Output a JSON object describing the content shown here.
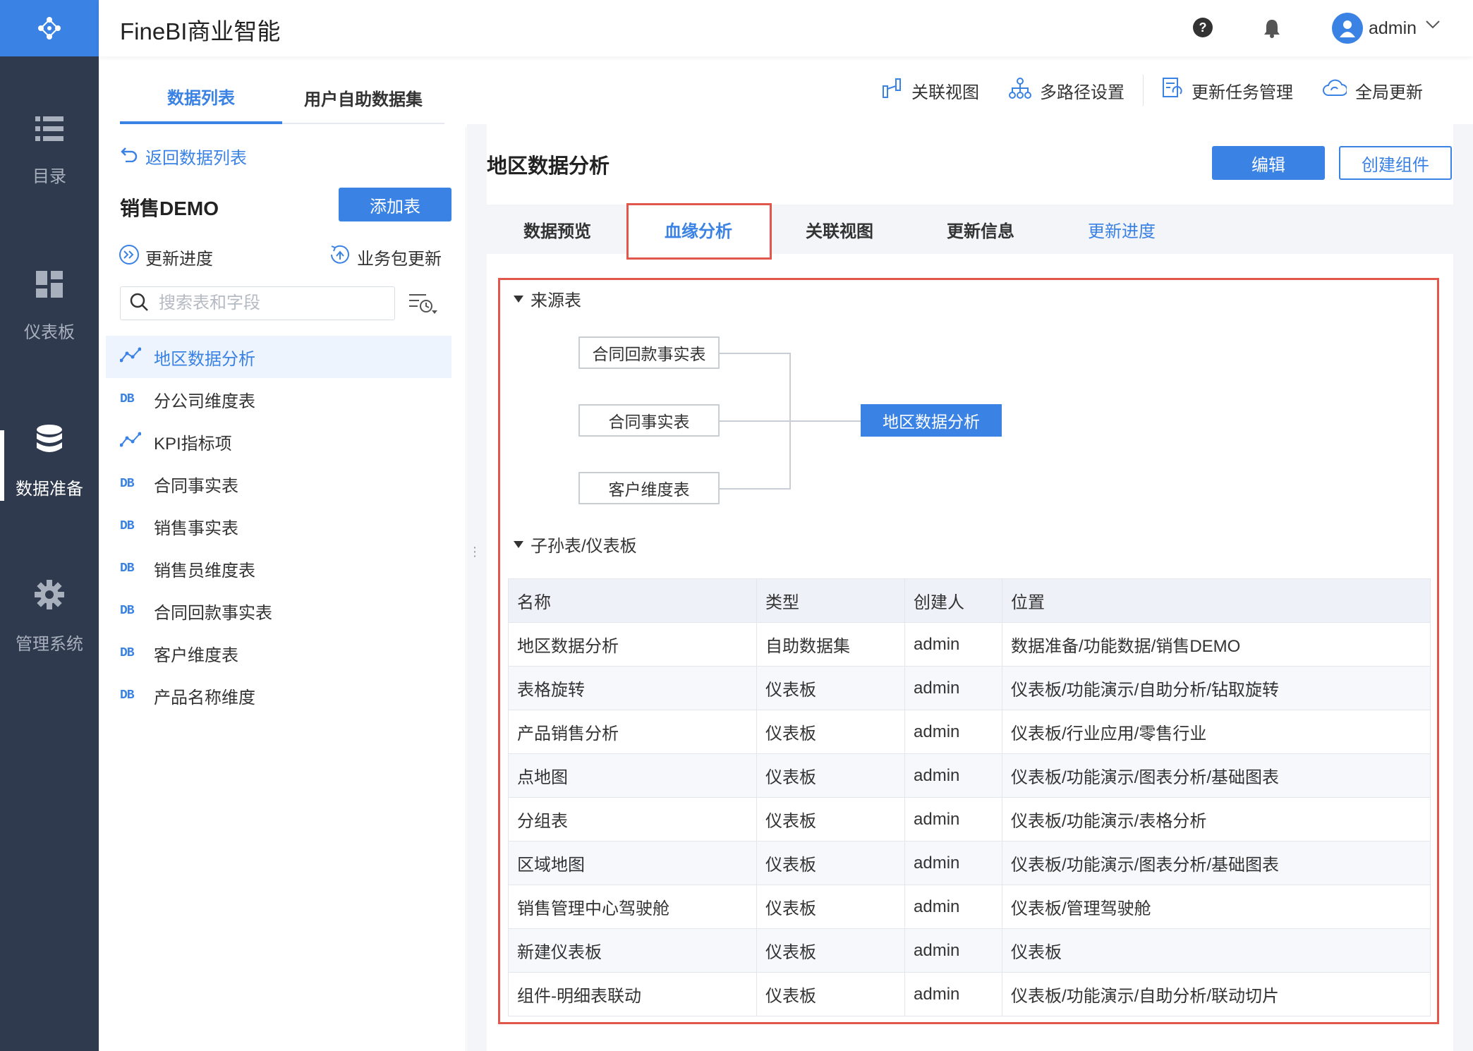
{
  "app": {
    "title": "FineBI商业智能"
  },
  "nav": {
    "items": [
      {
        "label": "目录",
        "icon": "list-icon"
      },
      {
        "label": "仪表板",
        "icon": "dashboard-icon"
      },
      {
        "label": "数据准备",
        "icon": "database-icon",
        "active": true
      },
      {
        "label": "管理系统",
        "icon": "gear-icon"
      }
    ]
  },
  "header": {
    "user": "admin"
  },
  "left": {
    "tabs": [
      "数据列表",
      "用户自助数据集"
    ],
    "back": "返回数据列表",
    "package_title": "销售DEMO",
    "add_table": "添加表",
    "update_progress": "更新进度",
    "package_update": "业务包更新",
    "search_placeholder": "搜索表和字段",
    "tables": [
      {
        "name": "地区数据分析",
        "type": "self-service",
        "active": true
      },
      {
        "name": "分公司维度表",
        "type": "DB"
      },
      {
        "name": "KPI指标项",
        "type": "self-service"
      },
      {
        "name": "合同事实表",
        "type": "DB"
      },
      {
        "name": "销售事实表",
        "type": "DB"
      },
      {
        "name": "销售员维度表",
        "type": "DB"
      },
      {
        "name": "合同回款事实表",
        "type": "DB"
      },
      {
        "name": "客户维度表",
        "type": "DB"
      },
      {
        "name": "产品名称维度",
        "type": "DB"
      }
    ],
    "db_badge": "DB"
  },
  "toolbar": {
    "items": [
      "关联视图",
      "多路径设置",
      "更新任务管理",
      "全局更新"
    ]
  },
  "main": {
    "title": "地区数据分析",
    "edit": "编辑",
    "create": "创建组件",
    "tabs": [
      "数据预览",
      "血缘分析",
      "关联视图",
      "更新信息",
      "更新进度"
    ],
    "source_section": "来源表",
    "sources": [
      "合同回款事实表",
      "合同事实表",
      "客户维度表"
    ],
    "result": "地区数据分析",
    "child_section": "子孙表/仪表板",
    "table_headers": [
      "名称",
      "类型",
      "创建人",
      "位置"
    ],
    "rows": [
      [
        "地区数据分析",
        "自助数据集",
        "admin",
        "数据准备/功能数据/销售DEMO"
      ],
      [
        "表格旋转",
        "仪表板",
        "admin",
        "仪表板/功能演示/自助分析/钻取旋转"
      ],
      [
        "产品销售分析",
        "仪表板",
        "admin",
        "仪表板/行业应用/零售行业"
      ],
      [
        "点地图",
        "仪表板",
        "admin",
        "仪表板/功能演示/图表分析/基础图表"
      ],
      [
        "分组表",
        "仪表板",
        "admin",
        "仪表板/功能演示/表格分析"
      ],
      [
        "区域地图",
        "仪表板",
        "admin",
        "仪表板/功能演示/图表分析/基础图表"
      ],
      [
        "销售管理中心驾驶舱",
        "仪表板",
        "admin",
        "仪表板/管理驾驶舱"
      ],
      [
        "新建仪表板",
        "仪表板",
        "admin",
        "仪表板"
      ],
      [
        "组件-明细表联动",
        "仪表板",
        "admin",
        "仪表板/功能演示/自助分析/联动切片"
      ]
    ]
  },
  "colors": {
    "accent": "#3a82e4",
    "nav": "#2f3a4e",
    "highlight": "#e2574c"
  }
}
